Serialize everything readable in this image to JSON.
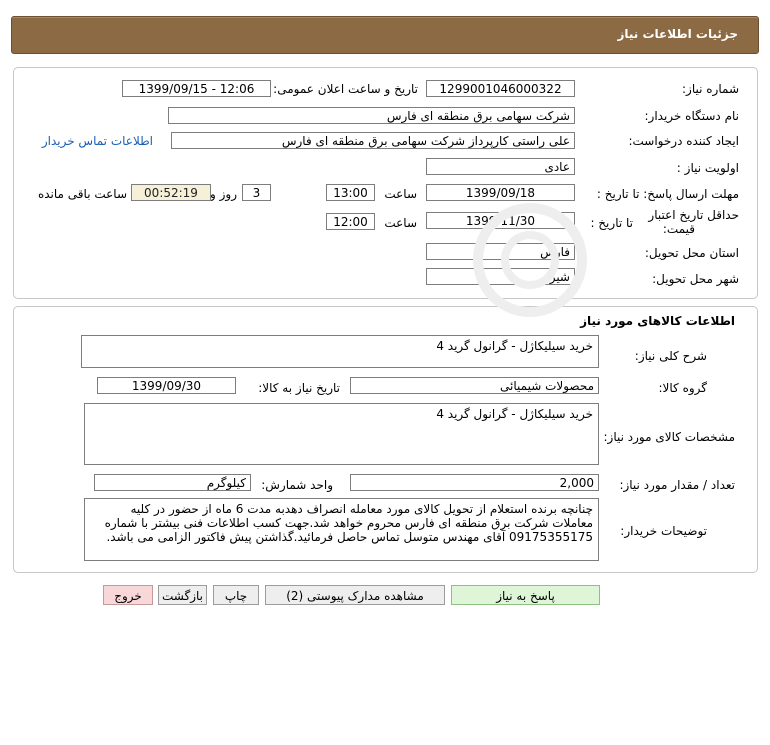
{
  "header": {
    "title": "جزئیات اطلاعات نیاز"
  },
  "info": {
    "need_number_label": "شماره نیاز:",
    "need_number": "1299001046000322",
    "announce_label": "تاریخ و ساعت اعلان عمومی:",
    "announce_value": "1399/09/15 - 12:06",
    "buyer_org_label": "نام دستگاه خریدار:",
    "buyer_org": "شرکت سهامی برق منطقه ای فارس",
    "creator_label": "ایجاد کننده درخواست:",
    "creator": "علی راستی کارپرداز شرکت سهامی برق منطقه ای فارس",
    "contact_link": "اطلاعات تماس خریدار",
    "priority_label": "اولویت نیاز :",
    "priority": "عادی",
    "deadline_label": "مهلت ارسال پاسخ: تا تاریخ :",
    "deadline_date": "1399/09/18",
    "hour_label": "ساعت",
    "deadline_time": "13:00",
    "days_value": "3",
    "days_label": "روز و",
    "remaining_time": "00:52:19",
    "remaining_label": "ساعت باقی مانده",
    "validity_label_1": "حداقل تاریخ اعتبار",
    "validity_label_2": "قیمت:",
    "validity_to_label": "تا تاریخ :",
    "validity_date": "1399/11/30",
    "validity_hour_label": "ساعت",
    "validity_time": "12:00",
    "province_label": "استان محل تحویل:",
    "province": "فارس",
    "city_label": "شهر محل تحویل:",
    "city": "شیراز"
  },
  "goods": {
    "section_title": "اطلاعات کالاهای مورد نیاز",
    "description_label": "شرح کلی نیاز:",
    "description": "خرید سیلیکاژل - گرانول گرید 4",
    "group_label": "گروه کالا:",
    "group": "محصولات شیمیائی",
    "need_date_label": "تاریخ نیاز به کالا:",
    "need_date": "1399/09/30",
    "specs_label": "مشخصات کالای مورد نیاز:",
    "specs": "خرید سیلیکاژل - گرانول گرید 4",
    "quantity_label": "تعداد / مقدار مورد نیاز:",
    "quantity": "2,000",
    "unit_label": "واحد شمارش:",
    "unit": "کیلوگرم",
    "buyer_notes_label": "توضیحات خریدار:",
    "buyer_notes": "چنانچه برنده استعلام از تحویل کالای مورد معامله انصراف دهدبه مدت 6 ماه از حضور در کلیه معاملات شرکت برق منطقه ای فارس محروم خواهد شد.جهت کسب اطلاعات فنی بیشتر با شماره 09175355175 آقای مهندس متوسل تماس حاصل فرمائید.گذاشتن پیش فاکتور الزامی می باشد."
  },
  "buttons": {
    "reply": "پاسخ به نیاز",
    "attachments": "مشاهده مدارک پیوستی (2)",
    "print": "چاپ",
    "back": "بازگشت",
    "exit": "خروج"
  },
  "colors": {
    "header_bg": "#8b6a44",
    "link": "#1a5fb4",
    "timer_bg": "#f6f0d8",
    "reply_button_bg": "#dff5d8",
    "exit_button_bg": "#f7d7d7"
  }
}
